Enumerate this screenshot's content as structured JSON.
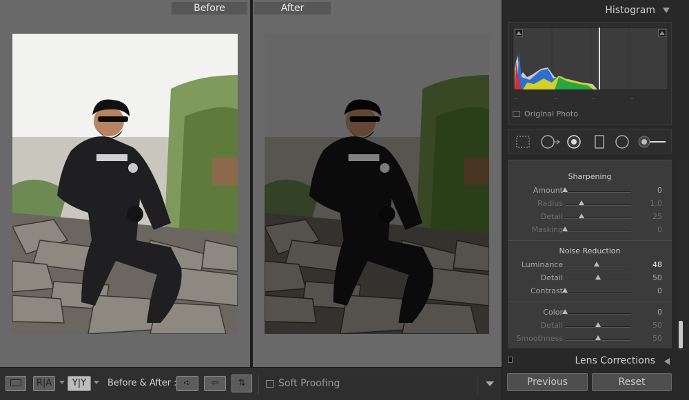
{
  "before_label": "Before",
  "after_label": "After",
  "toolbar": {
    "view_mode_icon": "loupe-rect-icon",
    "ra_label": "R|A",
    "yy_label": "Y|Y",
    "before_after_label": "Before & After :",
    "copy_before_to_after_icon": "arrow-right-icon",
    "copy_after_to_before_icon": "arrow-left-icon",
    "swap_icon": "swap-arrows-icon",
    "soft_proofing_label": "Soft Proofing",
    "menu_icon": "chevron-down-icon"
  },
  "histogram": {
    "title": "Histogram",
    "dashes": [
      "–",
      "–",
      "–",
      "–"
    ],
    "original_photo_label": "Original Photo"
  },
  "tools": [
    "crop-overlay-icon",
    "spot-removal-icon",
    "red-eye-icon",
    "graduated-filter-icon",
    "radial-filter-icon",
    "adjustment-brush-icon"
  ],
  "sharpening": {
    "title": "Sharpening",
    "rows": [
      {
        "label": "Amount",
        "value": "0",
        "pos": 0.0,
        "dim": false
      },
      {
        "label": "Radius",
        "value": "1,0",
        "pos": 0.25,
        "dim": true
      },
      {
        "label": "Detail",
        "value": "25",
        "pos": 0.25,
        "dim": true
      },
      {
        "label": "Masking",
        "value": "0",
        "pos": 0.0,
        "dim": true
      }
    ]
  },
  "noise_reduction": {
    "title": "Noise Reduction",
    "rows": [
      {
        "label": "Luminance",
        "value": "48",
        "pos": 0.48,
        "dim": false,
        "hi": true
      },
      {
        "label": "Detail",
        "value": "50",
        "pos": 0.5,
        "dim": false
      },
      {
        "label": "Contrast",
        "value": "0",
        "pos": 0.0,
        "dim": false
      },
      {
        "label": "Color",
        "value": "0",
        "pos": 0.0,
        "dim": false
      },
      {
        "label": "Detail",
        "value": "50",
        "pos": 0.5,
        "dim": true
      },
      {
        "label": "Smoothness",
        "value": "50",
        "pos": 0.5,
        "dim": true
      }
    ]
  },
  "lens_corrections_title": "Lens Corrections",
  "previous_label": "Previous",
  "reset_label": "Reset"
}
